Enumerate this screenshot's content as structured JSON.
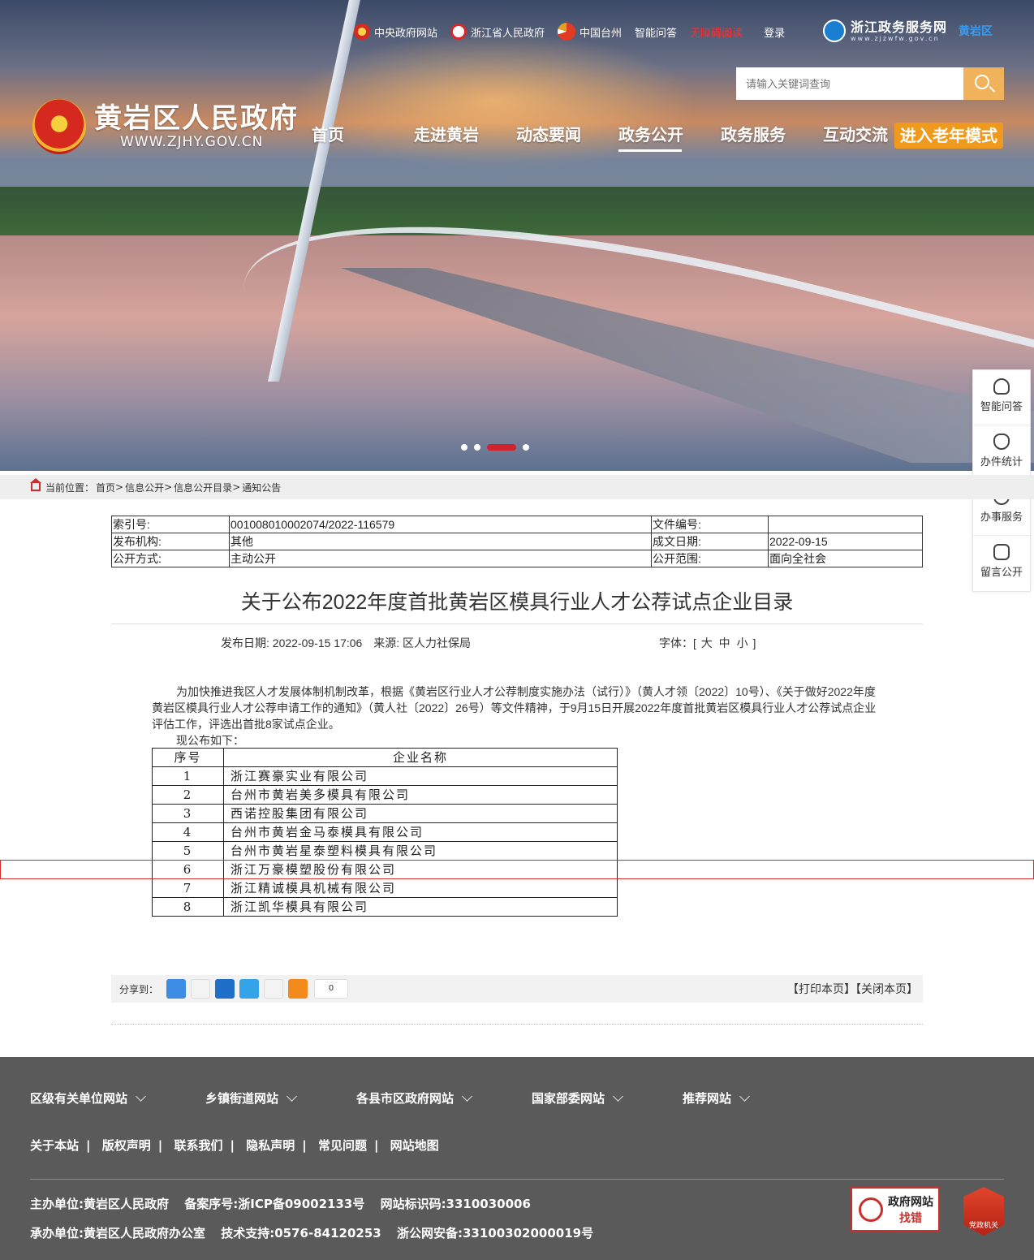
{
  "toplinks": {
    "items": [
      "中央政府网站",
      "浙江省人民政府",
      "中国台州",
      "智能问答"
    ],
    "accessible": "无障碍阅读",
    "login": "登录"
  },
  "zjfw": {
    "name": "浙江政务服务网",
    "url": "www.zjzwfw.gov.cn",
    "region": "黄岩区"
  },
  "search": {
    "placeholder": "请输入关键词查询"
  },
  "logo": {
    "title": "黄岩区人民政府",
    "url": "WWW.ZJHY.GOV.CN"
  },
  "nav": {
    "items": [
      "首页",
      "走进黄岩",
      "动态要闻",
      "政务公开",
      "政务服务",
      "互动交流"
    ],
    "active": "政务公开",
    "old_mode": "进入老年模式"
  },
  "sidepanel": {
    "items": [
      "智能问答",
      "办件统计",
      "办事服务",
      "留言公开"
    ]
  },
  "breadcrumb": {
    "label": "当前位置：",
    "items": [
      "首页",
      "信息公开",
      "信息公开目录",
      "通知公告"
    ],
    "sep": ">"
  },
  "meta": {
    "index_label": "索引号:",
    "index_value": "001008010002074/2022-116579",
    "docno_label": "文件编号:",
    "docno_value": "",
    "org_label": "发布机构:",
    "org_value": "其他",
    "date_label": "成文日期:",
    "date_value": "2022-09-15",
    "mode_label": "公开方式:",
    "mode_value": "主动公开",
    "scope_label": "公开范围:",
    "scope_value": "面向全社会"
  },
  "article": {
    "title": "关于公布2022年度首批黄岩区模具行业人才公荐试点企业目录",
    "publish": "发布日期: 2022-09-15 17:06",
    "source": "来源: 区人力社保局",
    "font_label": "字体：[",
    "font_large": "大",
    "font_mid": "中",
    "font_small": "小",
    "font_end": "]",
    "paragraph": "为加快推进我区人才发展体制机制改革，根据《黄岩区行业人才公荐制度实施办法（试行）》（黄人才领〔2022〕10号）、《关于做好2022年度黄岩区模具行业人才公荐申请工作的通知》（黄人社〔2022〕26号）等文件精神，于9月15日开展2022年度首批黄岩区模具行业人才公荐试点企业评估工作，评选出首批8家试点企业。",
    "paragraph2": "现公布如下："
  },
  "table": {
    "headers": [
      "序号",
      "企业名称"
    ],
    "rows": [
      [
        "1",
        "浙江赛豪实业有限公司"
      ],
      [
        "2",
        "台州市黄岩美多模具有限公司"
      ],
      [
        "3",
        "西诺控股集团有限公司"
      ],
      [
        "4",
        "台州市黄岩金马泰模具有限公司"
      ],
      [
        "5",
        "台州市黄岩星泰塑料模具有限公司"
      ],
      [
        "6",
        "浙江万豪模塑股份有限公司"
      ],
      [
        "7",
        "浙江精诚模具机械有限公司"
      ],
      [
        "8",
        "浙江凯华模具有限公司"
      ]
    ]
  },
  "share": {
    "label": "分享到：",
    "count": "0",
    "print": "【打印本页】",
    "close": "【关闭本页】"
  },
  "footer": {
    "links": [
      "区级有关单位网站",
      "乡镇街道网站",
      "各县市区政府网站",
      "国家部委网站",
      "推荐网站"
    ],
    "nav": [
      "关于本站",
      "版权声明",
      "联系我们",
      "隐私声明",
      "常见问题",
      "网站地图"
    ],
    "host": "主办单位:黄岩区人民政府",
    "icp": "备案序号:浙ICP备09002133号",
    "site_id": "网站标识码:3310030006",
    "operator": "承办单位:黄岩区人民政府办公室",
    "support": "技术支持:0576-84120253",
    "police": "浙公网安备:33100302000019号",
    "jiucuo1": "政府网站",
    "jiucuo2": "找错",
    "party": "党政机关"
  }
}
